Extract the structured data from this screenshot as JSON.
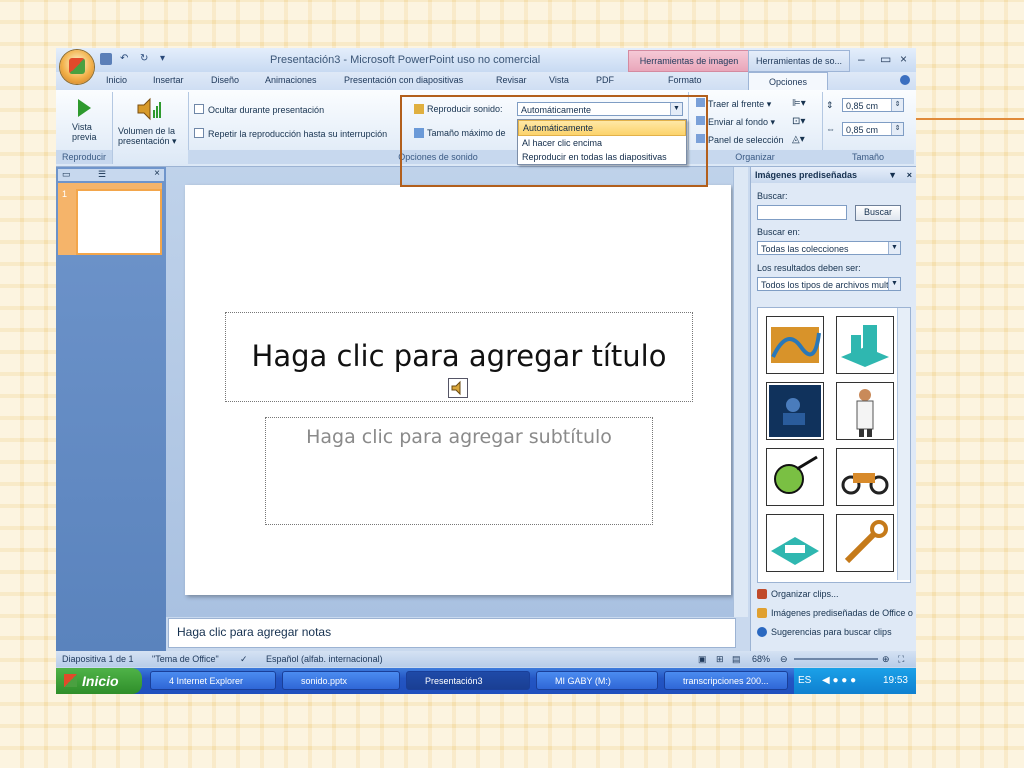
{
  "window": {
    "title": "Presentación3 - Microsoft PowerPoint uso no comercial",
    "context_tab_1": "Herramientas de imagen",
    "context_tab_2": "Herramientas de so...",
    "minimize": "–",
    "restore": "▭",
    "close": "×"
  },
  "tabs": [
    "Inicio",
    "Insertar",
    "Diseño",
    "Animaciones",
    "Presentación con diapositivas",
    "Revisar",
    "Vista",
    "PDF",
    "Formato",
    "Opciones"
  ],
  "ribbon": {
    "preview_label": "Vista previa",
    "preview_line1": "Vista",
    "preview_line2": "previa",
    "group_reproducir": "Reproducir",
    "volume_line1": "Volumen de la",
    "volume_line2": "presentación ▾",
    "hide_label": "Ocultar durante presentación",
    "repeat_label": "Repetir la reproducción hasta su interrupción",
    "play_sound_label": "Reproducir sonido:",
    "play_sound_value": "Automáticamente",
    "max_size_label": "Tamaño máximo de",
    "group_options": "Opciones de sonido",
    "bring_front": "Traer al frente ▾",
    "send_back": "Enviar al fondo ▾",
    "selection_pane": "Panel de selección",
    "group_organize": "Organizar",
    "height_value": "0,85 cm",
    "width_value": "0,85 cm",
    "group_size": "Tamaño"
  },
  "dropdown_options": [
    "Automáticamente",
    "Al hacer clic encima",
    "Reproducir en todas las diapositivas"
  ],
  "slides_pane": {
    "slide_number": "1",
    "close": "×"
  },
  "slide": {
    "title_placeholder": "Haga clic para agregar título",
    "subtitle_placeholder": "Haga clic para agregar subtítulo"
  },
  "notes_placeholder": "Haga clic para agregar notas",
  "clipart_pane": {
    "header": "Imágenes prediseñadas",
    "search_label": "Buscar:",
    "search_button": "Buscar",
    "search_in_label": "Buscar en:",
    "search_in_value": "Todas las colecciones",
    "results_label": "Los resultados deben ser:",
    "results_value": "Todos los tipos de archivos mult",
    "links": [
      "Organizar clips...",
      "Imágenes prediseñadas de Office o",
      "Sugerencias para buscar clips"
    ]
  },
  "status": {
    "slide_info": "Diapositiva 1 de 1",
    "theme": "\"Tema de Office\"",
    "language": "Español (alfab. internacional)",
    "zoom": "68%"
  },
  "taskbar": {
    "start": "Inicio",
    "items": [
      "4 Internet Explorer",
      "sonido.pptx",
      "Presentación3",
      "MI GABY (M:)",
      "transcripciones 200..."
    ],
    "lang": "ES",
    "clock": "19:53"
  },
  "colors": {
    "accent_orange": "#b25f1c",
    "ribbon_blue": "#c7d8ee",
    "taskbar_blue": "#2456c4"
  }
}
